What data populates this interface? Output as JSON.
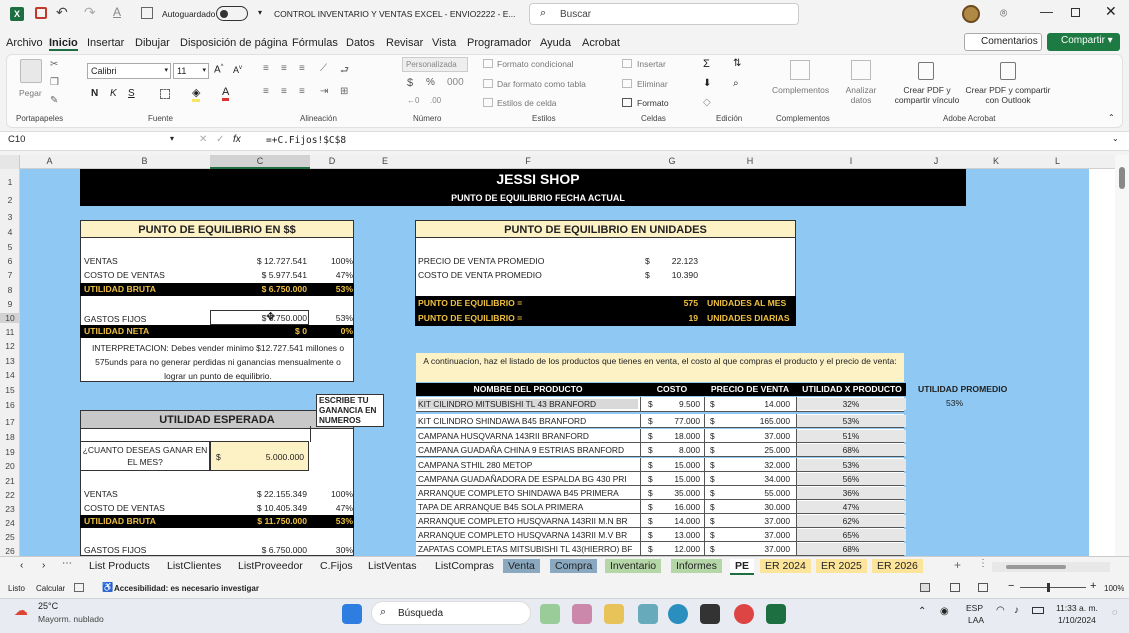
{
  "titlebar": {
    "autosave": "Autoguardado",
    "filename": "CONTROL INVENTARIO Y VENTAS EXCEL - ENVIO2222  -  E...",
    "search": "Buscar"
  },
  "menu": [
    "Archivo",
    "Inicio",
    "Insertar",
    "Dibujar",
    "Disposición de página",
    "Fórmulas",
    "Datos",
    "Revisar",
    "Vista",
    "Programador",
    "Ayuda",
    "Acrobat"
  ],
  "comments": "Comentarios",
  "share": "Compartir",
  "ribbon": {
    "paste": "Pegar",
    "font": "Calibri",
    "size": "11",
    "numfmt": "Personalizada",
    "cond": "Formato condicional",
    "astable": "Dar formato como tabla",
    "styles": "Estilos de celda",
    "insert": "Insertar",
    "delete": "Eliminar",
    "format": "Formato",
    "complements": "Complementos",
    "analyze": "Analizar datos",
    "pdf1": "Crear PDF y compartir vínculo",
    "pdf2": "Crear PDF y compartir con Outlook",
    "groups": [
      "Portapapeles",
      "Fuente",
      "Alineación",
      "Número",
      "Estilos",
      "Celdas",
      "Edición",
      "Complementos",
      "Adobe Acrobat"
    ]
  },
  "formula": {
    "cell": "C10",
    "fx": "fx",
    "content": "=+C.Fijos!$C$8"
  },
  "columns": [
    "A",
    "B",
    "C",
    "D",
    "E",
    "F",
    "G",
    "H",
    "I",
    "J",
    "K",
    "L"
  ],
  "rows": [
    "1",
    "2",
    "3",
    "4",
    "5",
    "6",
    "7",
    "8",
    "9",
    "10",
    "11",
    "12",
    "13",
    "14",
    "15",
    "16",
    "17",
    "18",
    "19",
    "20",
    "21",
    "22",
    "23",
    "24",
    "25",
    "26"
  ],
  "sheet": {
    "shop": "JESSI SHOP",
    "subtitle": "PUNTO DE EQUILIBRIO FECHA ACTUAL",
    "pe_money": {
      "title": "PUNTO DE EQUILIBRIO EN $$",
      "ventas": "VENTAS",
      "ventas_v": "$ 12.727.541",
      "ventas_p": "100%",
      "costo": "COSTO DE VENTAS",
      "costo_v": "$ 5.977.541",
      "costo_p": "47%",
      "ub": "UTILIDAD BRUTA",
      "ub_v": "$ 6.750.000",
      "ub_p": "53%",
      "gf": "GASTOS FIJOS",
      "gf_v": "$ 6.750.000",
      "gf_p": "53%",
      "un": "UTILIDAD NETA",
      "un_v": "$ 0",
      "un_p": "0%",
      "interp": "INTERPRETACION: Debes vender minimo $12.727.541 millones o 575unds para no generar perdidas ni ganancias mensualmente o lograr un punto de equilibrio."
    },
    "pe_units": {
      "title": "PUNTO DE EQUILIBRIO EN UNIDADES",
      "pv": "PRECIO DE VENTA PROMEDIO",
      "pv_v": "22.123",
      "cv": "COSTO DE VENTA PROMEDIO",
      "cv_v": "10.390",
      "pe1": "PUNTO DE EQUILIBRIO =",
      "pe1_v": "575",
      "pe1_u": "UNIDADES AL MES",
      "pe2": "PUNTO DE EQUILIBRIO =",
      "pe2_v": "19",
      "pe2_u": "UNIDADES DIARIAS"
    },
    "util": {
      "title": "UTILIDAD ESPERADA",
      "note": "ESCRIBE TU GANANCIA EN NUMEROS",
      "q": "¿CUANTO DESEAS GANAR EN EL MES?",
      "q_v": "5.000.000",
      "ventas": "VENTAS",
      "ventas_v": "$ 22.155.349",
      "ventas_p": "100%",
      "costo": "COSTO DE VENTAS",
      "costo_v": "$ 10.405.349",
      "costo_p": "47%",
      "ub": "UTILIDAD BRUTA",
      "ub_v": "$ 11.750.000",
      "ub_p": "53%",
      "gf": "GASTOS FIJOS",
      "gf_v": "$ 6.750.000",
      "gf_p": "30%"
    },
    "instr": "A continuacion, haz el listado de los productos que tienes en venta, el costo al que compras el producto y el precio de venta:",
    "headers": [
      "NOMBRE DEL PRODUCTO",
      "COSTO",
      "PRECIO DE VENTA",
      "UTILIDAD X PRODUCTO"
    ],
    "avg_label": "UTILIDAD PROMEDIO",
    "avg_value": "53%",
    "products": [
      {
        "name": "KIT CILINDRO MITSUBISHI TL 43  BRANFORD",
        "cost": "9.500",
        "price": "14.000",
        "util": "32%"
      },
      {
        "name": "KIT CILINDRO SHINDAWA B45  BRANFORD",
        "cost": "77.000",
        "price": "165.000",
        "util": "53%"
      },
      {
        "name": "CAMPANA HUSQVARNA 143RII BRANFORD",
        "cost": "18.000",
        "price": "37.000",
        "util": "51%"
      },
      {
        "name": "CAMPANA GUADAÑA CHINA 9 ESTRIAS BRANFORD",
        "cost": "8.000",
        "price": "25.000",
        "util": "68%"
      },
      {
        "name": "CAMPANA STHIL 280 METOP",
        "cost": "15.000",
        "price": "32.000",
        "util": "53%"
      },
      {
        "name": "CAMPANA GUADAÑADORA DE ESPALDA BG 430 PRI",
        "cost": "15.000",
        "price": "34.000",
        "util": "56%"
      },
      {
        "name": "ARRANQUE COMPLETO SHINDAWA B45 PRIMERA",
        "cost": "35.000",
        "price": "55.000",
        "util": "36%"
      },
      {
        "name": "TAPA DE ARRANQUE B45 SOLA  PRIMERA",
        "cost": "16.000",
        "price": "30.000",
        "util": "47%"
      },
      {
        "name": "ARRANQUE COMPLETO HUSQVARNA 143RII M.N BR",
        "cost": "14.000",
        "price": "37.000",
        "util": "62%"
      },
      {
        "name": "ARRANQUE COMPLETO HUSQVARNA 143RII M.V BR",
        "cost": "13.000",
        "price": "37.000",
        "util": "65%"
      },
      {
        "name": "ZAPATAS COMPLETAS MITSUBISHI TL 43(HIERRO) BF",
        "cost": "12.000",
        "price": "37.000",
        "util": "68%"
      }
    ]
  },
  "tabs": [
    "List Products",
    "ListClientes",
    "ListProveedor",
    "C.Fijos",
    "ListVentas",
    "ListCompras",
    "Venta",
    "Compra",
    "Inventario",
    "Informes",
    "PE",
    "ER 2024",
    "ER 2025",
    "ER 2026"
  ],
  "status": {
    "ready": "Listo",
    "calc": "Calcular",
    "access": "Accesibilidad: es necesario investigar",
    "zoom": "100%"
  },
  "taskbar": {
    "temp": "25°C",
    "weather": "Mayorm. nublado",
    "search": "Búsqueda",
    "lang1": "ESP",
    "lang2": "LAA",
    "time": "11:33 a. m.",
    "date": "1/10/2024"
  }
}
